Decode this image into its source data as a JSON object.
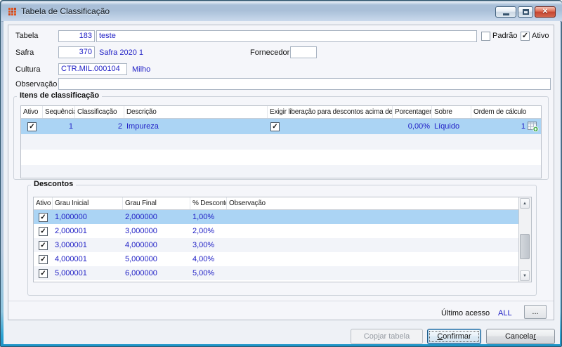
{
  "window": {
    "title": "Tabela de Classificação"
  },
  "icons": {
    "app": "orange-grid",
    "minimize": "minimize-dash",
    "maximize": "restore-box",
    "close": "✕",
    "check": "✓",
    "scroll_up": "▲",
    "scroll_down": "▼",
    "calc_order": "grid-add"
  },
  "form": {
    "tabela_label": "Tabela",
    "tabela_code": "183",
    "tabela_name": "teste",
    "padrao_label": "Padrão",
    "padrao_checked": false,
    "ativo_label": "Ativo",
    "ativo_checked": true,
    "safra_label": "Safra",
    "safra_code": "370",
    "safra_name": "Safra 2020 1",
    "fornecedor_label": "Fornecedor",
    "fornecedor_value": "",
    "cultura_label": "Cultura",
    "cultura_code": "CTR.MIL.000104",
    "cultura_name": "Milho",
    "observacao_label": "Observação",
    "observacao_value": ""
  },
  "itens": {
    "title": "Itens de classificação",
    "columns": [
      "Ativo",
      "Sequência",
      "Classificação",
      "Descrição",
      "Exigir liberação para descontos acima de",
      "Porcentagem",
      "Sobre",
      "Ordem de cálculo"
    ],
    "row": {
      "ativo": true,
      "sequencia": "1",
      "classificacao": "2",
      "descricao": "Impureza",
      "exigir_liberacao": true,
      "porcentagem": "0,00%",
      "sobre": "Líquido",
      "ordem_calculo": "1"
    }
  },
  "descontos": {
    "title": "Descontos",
    "columns": [
      "Ativo",
      "Grau Inicial",
      "Grau Final",
      "% Desconto",
      "Observação"
    ],
    "rows": [
      {
        "ativo": true,
        "grau_inicial": "1,000000",
        "grau_final": "2,000000",
        "desconto": "1,00%",
        "observacao": ""
      },
      {
        "ativo": true,
        "grau_inicial": "2,000001",
        "grau_final": "3,000000",
        "desconto": "2,00%",
        "observacao": ""
      },
      {
        "ativo": true,
        "grau_inicial": "3,000001",
        "grau_final": "4,000000",
        "desconto": "3,00%",
        "observacao": ""
      },
      {
        "ativo": true,
        "grau_inicial": "4,000001",
        "grau_final": "5,000000",
        "desconto": "4,00%",
        "observacao": ""
      },
      {
        "ativo": true,
        "grau_inicial": "5,000001",
        "grau_final": "6,000000",
        "desconto": "5,00%",
        "observacao": ""
      }
    ],
    "selected_row_index": 0
  },
  "footer": {
    "ultimo_acesso_label": "Último acesso",
    "ultimo_acesso_value": "ALL",
    "browse_label": "...",
    "copiar": {
      "pre": "Cop",
      "mnemonic": "i",
      "post": "ar tabela"
    },
    "confirmar": {
      "pre": "",
      "mnemonic": "C",
      "post": "onfirmar"
    },
    "cancelar": {
      "pre": "Cancela",
      "mnemonic": "r",
      "post": ""
    }
  },
  "colors": {
    "data_text": "#2121c6",
    "selection_bg": "#abd4f4",
    "titlebar_top": "#a9bfd8",
    "titlebar_bottom": "#c9d9ec",
    "frame_accent": "#2aa2d2"
  }
}
